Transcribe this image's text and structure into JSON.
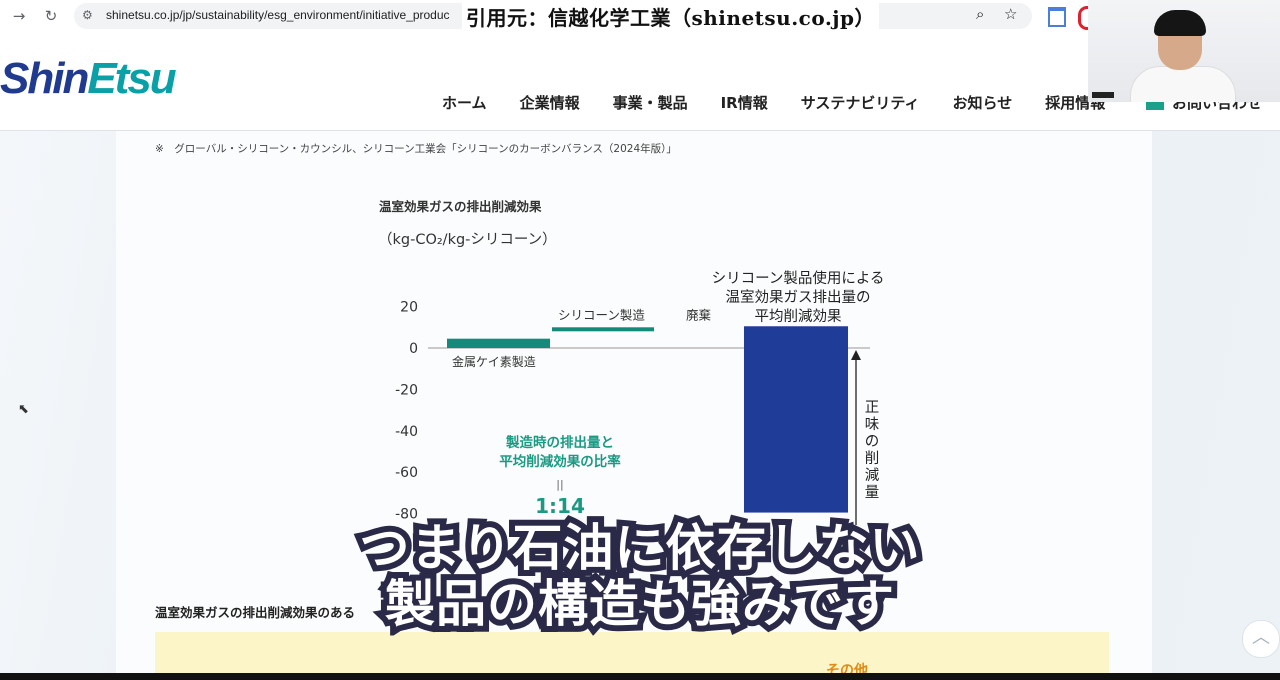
{
  "browser": {
    "url": "shinetsu.co.jp/jp/sustainability/esg_environment/initiative_produc",
    "credit": "引用元：信越化学工業（shinetsu.co.jp）",
    "icons": [
      "back-arrow-icon",
      "reload-icon",
      "site-info-icon",
      "zoom-icon",
      "bookmark-star-icon",
      "calendar-extension-icon",
      "red-extension-icon"
    ]
  },
  "header": {
    "logo_left": "Shin",
    "logo_right": "Etsu",
    "nav": [
      "ホーム",
      "企業情報",
      "事業・製品",
      "IR情報",
      "サステナビリティ",
      "お知らせ",
      "採用情報"
    ],
    "contact": "お問い合わせ"
  },
  "page": {
    "note": "※　グローバル・シリコーン・カウンシル、シリコーン工業会「シリコーンのカーボンバランス（2024年版）」",
    "chart_title": "温室効果ガスの排出削減効果",
    "unit": "（kg-CO₂/kg-シリコーン）",
    "section2": "温室効果ガスの排出削減効果のある",
    "other_label": "その他"
  },
  "chart_data": {
    "type": "bar",
    "categories": [
      "金属ケイ素製造",
      "シリコーン製造",
      "廃棄",
      "シリコーン製品使用による温室効果ガス排出量の平均削減効果"
    ],
    "values": [
      4.5,
      5.5,
      0.5,
      -90
    ],
    "yticks": [
      20,
      0,
      -20,
      -40,
      -60,
      -80
    ],
    "ylim": [
      -85,
      25
    ],
    "bar_label": [
      "シリコーン製品使用による",
      "温室効果ガス排出量の",
      "平均削減効果"
    ],
    "ratio_label": [
      "製造時の排出量と",
      "平均削減効果の比率"
    ],
    "ratio_eq": "||",
    "ratio": "1:14",
    "arrow_label": "正味の削減量",
    "colors": {
      "manufacturing": "#138a7a",
      "reduction": "#1f3c99",
      "ratio_text": "#1a9a82"
    }
  },
  "subtitle": {
    "line1": "つまり石油に依存しない",
    "line2": "製品の構造も強みです"
  },
  "scroll_top_icon": "chevron-up-icon",
  "cursor_icon": "mouse-cursor-icon"
}
